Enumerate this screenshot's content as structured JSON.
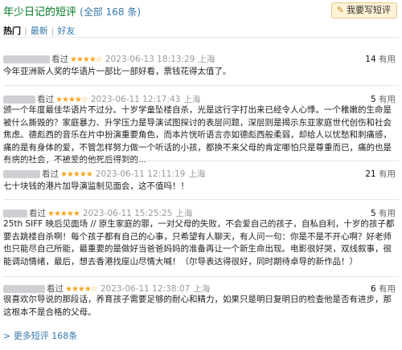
{
  "header": {
    "title": "年少日记的短评",
    "count": "全部 168 条",
    "write_button": "我要写短评"
  },
  "tabs": [
    {
      "label": "热门",
      "active": true
    },
    {
      "label": "最新",
      "active": false
    },
    {
      "label": "好友",
      "active": false
    }
  ],
  "reviews": [
    {
      "status": "看过",
      "stars": "★★★★☆",
      "time": "2023-06-13 18:13:29",
      "location": "上海",
      "useful_count": "14",
      "useful_label": "有用",
      "content": "今年亚洲新人奖的华语片一部比一部好看，票钱花得太值了。"
    },
    {
      "status": "看过",
      "stars": "★★★★☆",
      "time": "2023-06-11 12:17:43",
      "location": "上海",
      "useful_count": "5",
      "useful_label": "有用",
      "content": "颁一个年度最佳华语片不过分。十岁学童坠楼自杀，光是这行字打出来已经令人心悸。一个稚嫩的生命是被什么撕毁的？家庭暴力、升学压力是导演试图探讨的表层问题，深层则是揭示东亚家庭世代创伤和社会焦虑。德彪西的音乐在片中扮演重要角色，而本片恍听语言亦如德彪西般柔弱，却给人以忧愁和刺痛感，痛的是有身体的爱，不管怎样努力做一个听话的小孩，都换不来父母的肯定哪怕只是尊重而已，痛的也是有病的社会，不被爱的他死后得到的..."
    },
    {
      "status": "看过",
      "stars": "★★★★★",
      "time": "2023-06-11 12:11:19",
      "location": "上海",
      "useful_count": "21",
      "useful_label": "有用",
      "content": "七十块钱的港片加导演监制见面会，这不值吗！！"
    },
    {
      "status": "看过",
      "stars": "★★★★★",
      "time": "2023-06-11 15:25:25",
      "location": "上海",
      "useful_count": "5",
      "useful_label": "有用",
      "content": "25th SIFF 映后见面场 // 原生家庭的罪，一对父母的失败，不会爱自己的孩子，自私自利，十岁的孩子都要去跳楼自杀啊！每个孩子都有自己的心事，只希望有人聊天，有人问一句：你是不是不开心啊？好老师也只能尽自己所能，最重要的是做好当爸爸妈妈的准备再让一个新生命出现。电影很好哭，双线叙事，很能调动情绪，最后，想去香港找座山尽情大喊！（尔导表达得很好，同时期待卓导的新作品！）"
    },
    {
      "status": "看过",
      "stars": "★★★★☆",
      "time": "2023-06-11 12:38:07",
      "location": "上海",
      "useful_count": "6",
      "useful_label": "有用",
      "content": "很喜欢尔导说的那段话，养育孩子需要足够的耐心和精力，如果只是明日复明日的检查他是否有进步，那这根本不是合格的父母。"
    }
  ],
  "footer": {
    "more_link": "> 更多短评 168条"
  }
}
